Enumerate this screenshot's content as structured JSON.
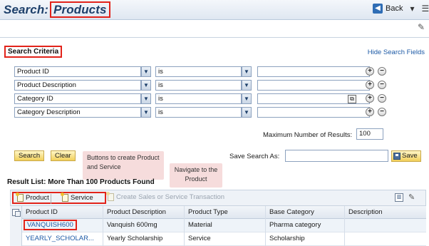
{
  "header": {
    "title_prefix": "Search:",
    "title_object": "Products",
    "back_label": "Back",
    "back_icon": "arrow-left-icon",
    "menu_icon": "chevron-down-icon"
  },
  "search": {
    "section_title": "Search Criteria",
    "hide_link": "Hide Search Fields",
    "rows": [
      {
        "field": "Product ID",
        "operator": "is",
        "value": ""
      },
      {
        "field": "Product Description",
        "operator": "is",
        "value": ""
      },
      {
        "field": "Category ID",
        "operator": "is",
        "value": ""
      },
      {
        "field": "Category Description",
        "operator": "is",
        "value": ""
      }
    ],
    "max_results_label": "Maximum Number of Results:",
    "max_results_value": "100",
    "search_button": "Search",
    "clear_button": "Clear",
    "save_as_label": "Save Search As:",
    "save_as_value": "",
    "save_button": "Save"
  },
  "callouts": {
    "buttons_note": "Buttons to create Product and Service",
    "navigate_note": "Navigate to the Product"
  },
  "results": {
    "title": "Result List: More Than 100 Products Found",
    "toolbar": {
      "product_button": "Product",
      "service_button": "Service",
      "create_transaction": "Create Sales or Service Transaction"
    },
    "columns": [
      "Product ID",
      "Product Description",
      "Product Type",
      "Base Category",
      "Description"
    ],
    "rows": [
      {
        "product_id": "VANQUISH600",
        "description": "Vanquish 600mg",
        "type": "Material",
        "category": "Pharma category",
        "desc2": ""
      },
      {
        "product_id": "YEARLY_SCHOLAR...",
        "description": "Yearly Scholarship",
        "type": "Service",
        "category": "Scholarship",
        "desc2": ""
      }
    ]
  },
  "colors": {
    "highlight": "#e2231a",
    "link": "#1d5aa6",
    "title": "#1d3f6a",
    "button": "#f2cf59",
    "callout": "#f6dcdc"
  }
}
